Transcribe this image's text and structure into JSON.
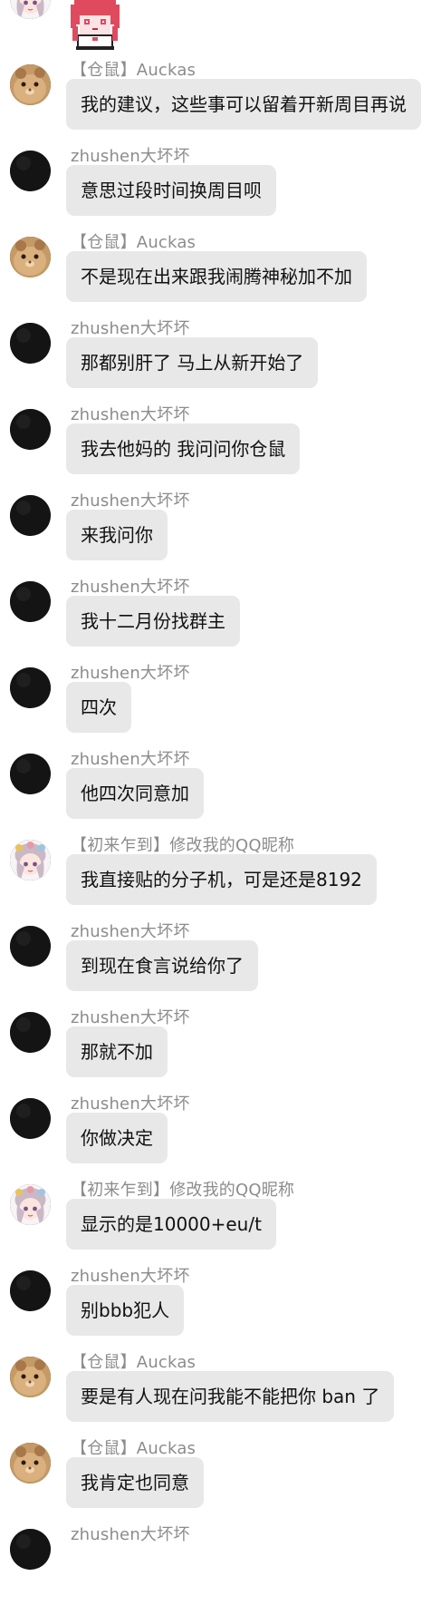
{
  "messages": [
    {
      "sender": "【初来乍到】修改我的QQ昵称",
      "avatar": "anime-girl-avatar",
      "text": "",
      "sticker": "pixel-anime-girl-sticker"
    },
    {
      "sender": "【仓鼠】Auckas",
      "avatar": "hamster-avatar",
      "text": "我的建议，这些事可以留着开新周目再说"
    },
    {
      "sender": "zhushen大坏坏",
      "avatar": "black-circle-avatar",
      "text": "意思过段时间换周目呗"
    },
    {
      "sender": "【仓鼠】Auckas",
      "avatar": "hamster-avatar",
      "text": "不是现在出来跟我闹腾神秘加不加"
    },
    {
      "sender": "zhushen大坏坏",
      "avatar": "black-circle-avatar",
      "text": "那都别肝了 马上从新开始了"
    },
    {
      "sender": "zhushen大坏坏",
      "avatar": "black-circle-avatar",
      "text": "我去他妈的 我问问你仓鼠"
    },
    {
      "sender": "zhushen大坏坏",
      "avatar": "black-circle-avatar",
      "text": "来我问你"
    },
    {
      "sender": "zhushen大坏坏",
      "avatar": "black-circle-avatar",
      "text": "我十二月份找群主"
    },
    {
      "sender": "zhushen大坏坏",
      "avatar": "black-circle-avatar",
      "text": "四次"
    },
    {
      "sender": "zhushen大坏坏",
      "avatar": "black-circle-avatar",
      "text": "他四次同意加"
    },
    {
      "sender": "【初来乍到】修改我的QQ昵称",
      "avatar": "anime-girl-avatar",
      "text": "我直接贴的分子机，可是还是8192"
    },
    {
      "sender": "zhushen大坏坏",
      "avatar": "black-circle-avatar",
      "text": "到现在食言说给你了"
    },
    {
      "sender": "zhushen大坏坏",
      "avatar": "black-circle-avatar",
      "text": "那就不加"
    },
    {
      "sender": "zhushen大坏坏",
      "avatar": "black-circle-avatar",
      "text": "你做决定"
    },
    {
      "sender": "【初来乍到】修改我的QQ昵称",
      "avatar": "anime-girl-avatar",
      "text": "显示的是10000+eu/t"
    },
    {
      "sender": "zhushen大坏坏",
      "avatar": "black-circle-avatar",
      "text": "别bbb犯人"
    },
    {
      "sender": "【仓鼠】Auckas",
      "avatar": "hamster-avatar",
      "text": "要是有人现在问我能不能把你 ban 了"
    },
    {
      "sender": "【仓鼠】Auckas",
      "avatar": "hamster-avatar",
      "text": "我肯定也同意"
    },
    {
      "sender": "zhushen大坏坏",
      "avatar": "black-circle-avatar",
      "text": ""
    }
  ],
  "colors": {
    "bubble": "#e8e8e8",
    "sender": "#8c8c8c",
    "text": "#111111",
    "background": "#ffffff"
  }
}
